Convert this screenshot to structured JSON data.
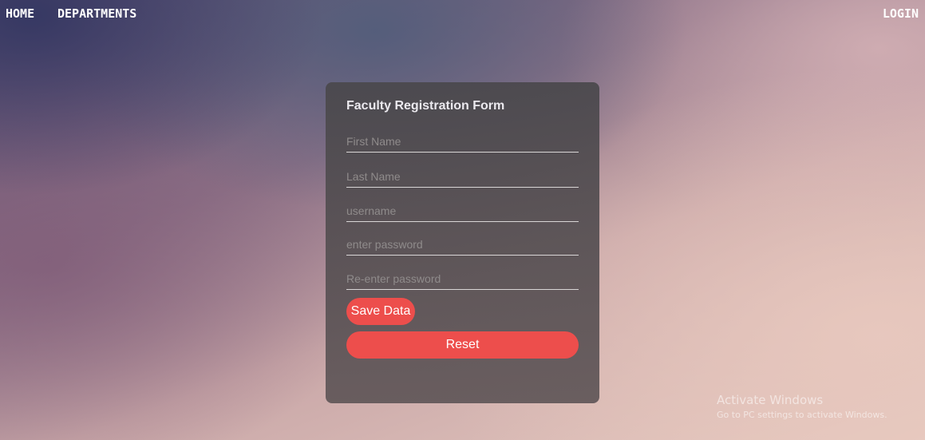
{
  "nav": {
    "home": "HOME",
    "departments": "DEPARTMENTS",
    "login": "LOGIN"
  },
  "form": {
    "title": "Faculty Registration Form",
    "fields": [
      {
        "placeholder": "First Name",
        "value": ""
      },
      {
        "placeholder": "Last Name",
        "value": ""
      },
      {
        "placeholder": "username",
        "value": ""
      },
      {
        "placeholder": "enter password",
        "value": ""
      },
      {
        "placeholder": "Re-enter password",
        "value": ""
      }
    ],
    "save_label": "Save Data",
    "reset_label": "Reset"
  },
  "watermark": {
    "title": "Activate Windows",
    "subtitle": "Go to PC settings to activate Windows."
  },
  "colors": {
    "button": "#ed4e4c",
    "card": "#4a484c",
    "field_underline": "#d9d6d6"
  }
}
